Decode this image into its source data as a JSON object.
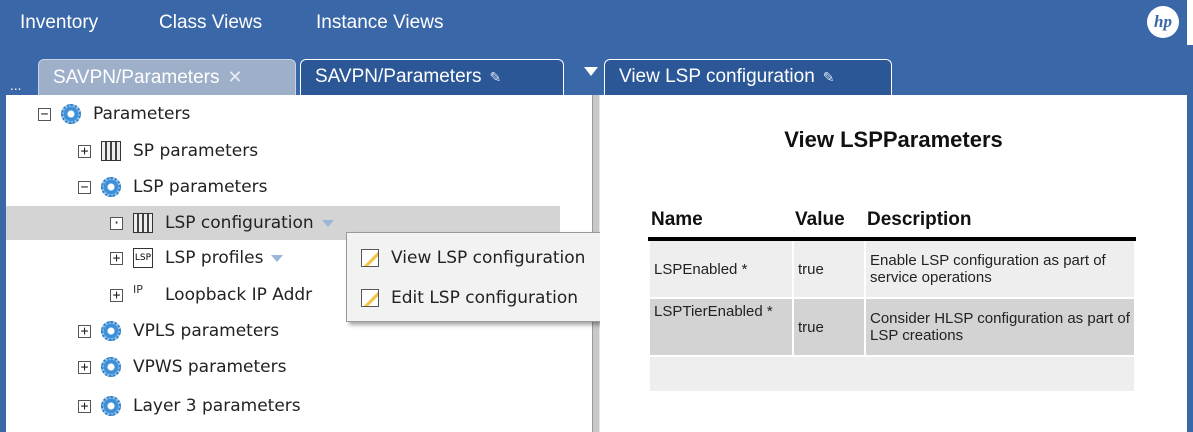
{
  "menubar": {
    "items": [
      "Inventory",
      "Class Views",
      "Instance Views"
    ],
    "logo": "hp"
  },
  "tabs": {
    "overflow": "...",
    "left_tabs": [
      {
        "label": "SAVPN/Parameters",
        "close": "✕"
      },
      {
        "label": "SAVPN/Parameters"
      }
    ],
    "right_tab": {
      "label": "View LSP configuration"
    }
  },
  "tree": [
    {
      "label": "Parameters",
      "expander": "−",
      "icon": "gear-icon"
    },
    {
      "label": "SP parameters",
      "expander": "+",
      "icon": "table-icon"
    },
    {
      "label": "LSP parameters",
      "expander": "−",
      "icon": "gear-icon"
    },
    {
      "label": "LSP configuration",
      "expander": "·",
      "icon": "table-icon",
      "selected": true
    },
    {
      "label": "LSP profiles",
      "expander": "+",
      "icon": "lsp-icon",
      "icon_text": "LSP"
    },
    {
      "label": "Loopback IP Addr",
      "expander": "+",
      "icon": "loopback-icon",
      "icon_text": "IP"
    },
    {
      "label": "VPLS parameters",
      "expander": "+",
      "icon": "gear-icon"
    },
    {
      "label": "VPWS parameters",
      "expander": "+",
      "icon": "gear-icon"
    },
    {
      "label": "Layer 3 parameters",
      "expander": "+",
      "icon": "gear-icon"
    }
  ],
  "context_menu": {
    "items": [
      "View LSP configuration",
      "Edit LSP configuration"
    ]
  },
  "right": {
    "title": "View LSPParameters",
    "columns": [
      "Name",
      "Value",
      "Description"
    ],
    "rows": [
      {
        "name": "LSPEnabled *",
        "value": "true",
        "description": "Enable LSP configuration as part of service operations"
      },
      {
        "name": "LSPTierEnabled *",
        "value": "true",
        "description": "Consider HLSP configuration as part of LSP creations"
      }
    ]
  },
  "colors": {
    "bar": "#3a67a8",
    "active_tab": "#2b5797",
    "inactive_tab": "#9dafc9"
  }
}
